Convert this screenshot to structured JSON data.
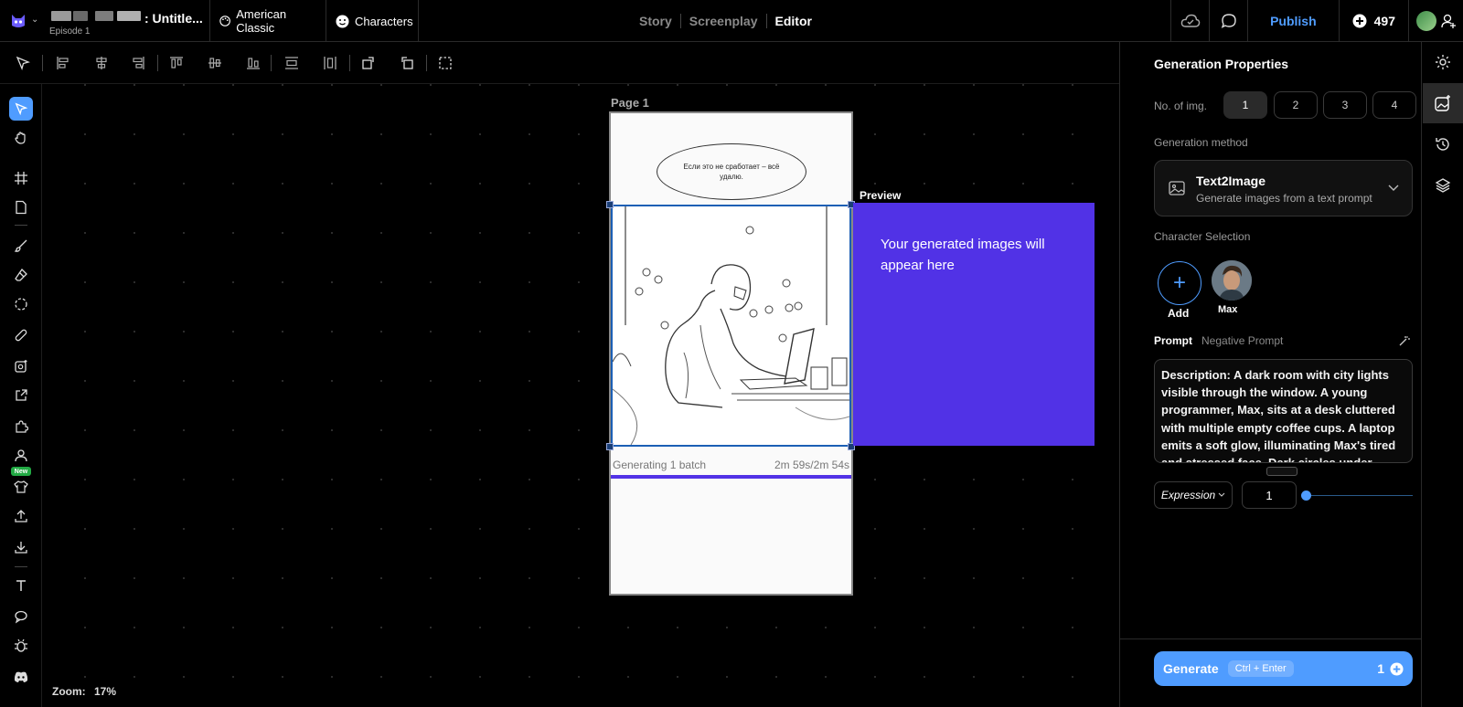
{
  "header": {
    "project_title": ": Untitle...",
    "episode": "Episode 1",
    "style_name": "American Classic",
    "characters_label": "Characters",
    "tabs": [
      {
        "label": "Story"
      },
      {
        "label": "Screenplay"
      },
      {
        "label": "Editor"
      }
    ],
    "active_tab": "Editor",
    "publish_label": "Publish",
    "credits": "497"
  },
  "canvas": {
    "page_label": "Page 1",
    "bubble_text": "Если это не сработает – всё удалю.",
    "generating_label": "Generating 1 batch",
    "generating_time": "2m 59s/2m 54s",
    "preview_label": "Preview",
    "preview_text": "Your generated images will appear here",
    "zoom_label": "Zoom:",
    "zoom_value": "17%"
  },
  "left_rail": {
    "new_badge": "New"
  },
  "right_panel": {
    "title": "Generation Properties",
    "num_images_label": "No. of img.",
    "num_images_options": [
      "1",
      "2",
      "3",
      "4"
    ],
    "num_images_selected": "1",
    "method_label": "Generation method",
    "method_title": "Text2Image",
    "method_subtitle": "Generate images from a text prompt",
    "character_label": "Character Selection",
    "add_label": "Add",
    "character_name": "Max",
    "prompt_tab": "Prompt",
    "negative_tab": "Negative Prompt",
    "prompt_text": "Description: A dark room with city lights visible through the window. A young programmer, Max, sits at a desk cluttered with multiple empty coffee cups. A laptop emits a soft glow, illuminating Max's tired and stressed face. Dark circles under",
    "expression_label": "Expression",
    "expression_value": "1",
    "generate_label": "Generate",
    "generate_shortcut": "Ctrl + Enter",
    "generate_cost": "1"
  },
  "colors": {
    "accent": "#4f9cff",
    "preview_bg": "#5132e6",
    "panel_border": "#1b5fb5",
    "new_badge": "#22aa44"
  }
}
